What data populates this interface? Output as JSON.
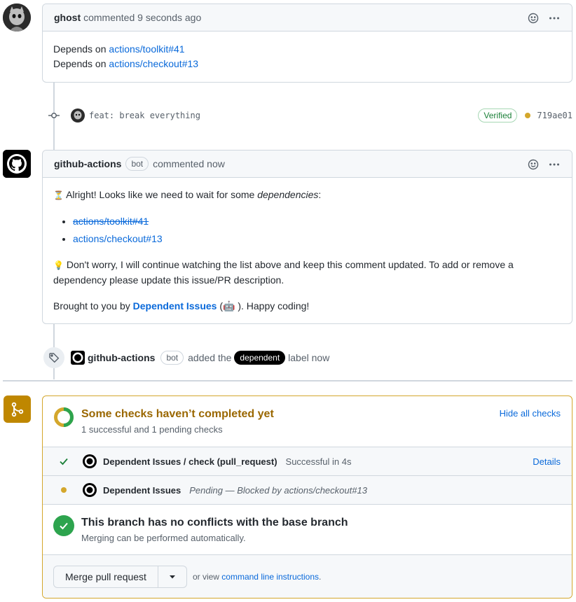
{
  "comment1": {
    "author": "ghost",
    "action": "commented",
    "time": "9 seconds ago",
    "lines": [
      {
        "prefix": "Depends on ",
        "link": "actions/toolkit#41"
      },
      {
        "prefix": "Depends on ",
        "link": "actions/checkout#13"
      }
    ]
  },
  "commit": {
    "message": "feat: break everything",
    "verified": "Verified",
    "sha": "719ae01",
    "status_color": "#d4a72c"
  },
  "comment2": {
    "author": "github-actions",
    "badge": "bot",
    "action": "commented now",
    "intro_emoji": "⏳",
    "intro_text": " Alright! Looks like we need to wait for some ",
    "intro_em": "dependencies",
    "intro_end": ":",
    "deps": [
      {
        "label": "actions/toolkit#41",
        "done": true
      },
      {
        "label": "actions/checkout#13",
        "done": false
      }
    ],
    "tip_emoji": "💡",
    "tip_text": " Don't worry, I will continue watching the list above and keep this comment updated. To add or remove a dependency please update this issue/PR description.",
    "footer_prefix": "Brought to you by ",
    "footer_link": "Dependent Issues",
    "footer_emoji": "(🤖 ). Happy coding!"
  },
  "label_event": {
    "actor": "github-actions",
    "badge": "bot",
    "action": "added the",
    "label": "dependent",
    "suffix": "label now"
  },
  "checks": {
    "title": "Some checks haven’t completed yet",
    "subtitle": "1 successful and 1 pending checks",
    "toggle": "Hide all checks",
    "items": [
      {
        "name": "Dependent Issues / check (pull_request)",
        "status": "Successful in 4s",
        "link": "Details"
      },
      {
        "name": "Dependent Issues",
        "status": "Pending — Blocked by actions/checkout#13"
      }
    ]
  },
  "conflicts": {
    "title": "This branch has no conflicts with the base branch",
    "subtitle": "Merging can be performed automatically."
  },
  "merge": {
    "button": "Merge pull request",
    "or_view": "or view ",
    "cli_link": "command line instructions",
    "period": "."
  },
  "colors": {
    "link": "#0969da",
    "pending": "#d4a72c",
    "success": "#2da44e",
    "title_pending": "#9a6700"
  }
}
